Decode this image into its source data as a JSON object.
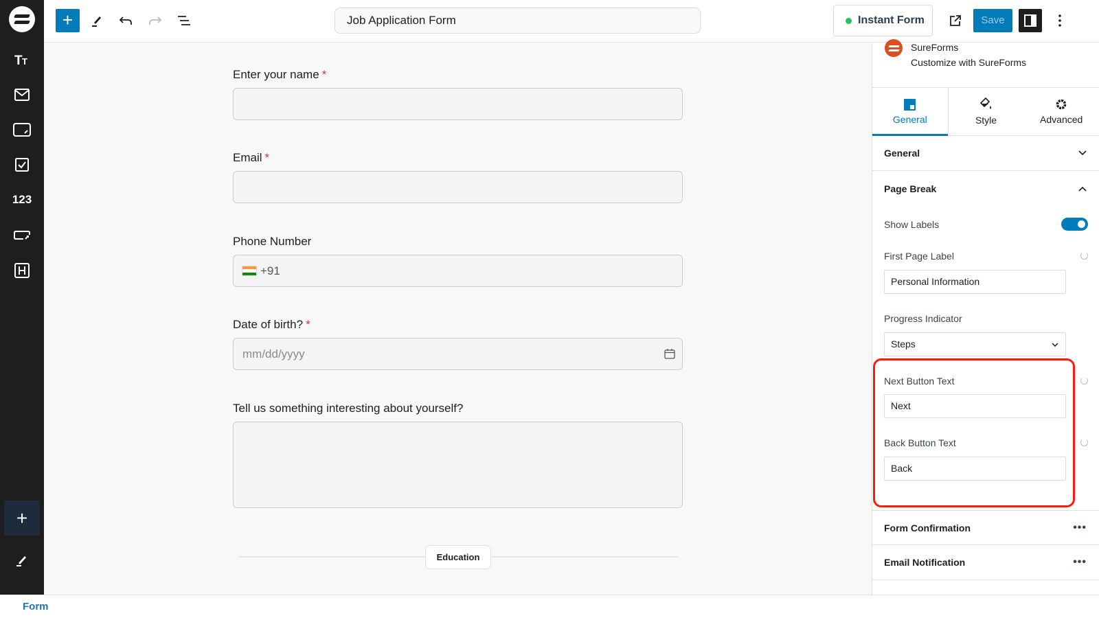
{
  "header": {
    "title": "Job Application Form",
    "instant_form_label": "Instant Form",
    "instant_form_status_color": "#22c55e",
    "save_label": "Save",
    "accent": "#007cba"
  },
  "left_toolbar": {
    "items": [
      {
        "icon": "text-icon"
      },
      {
        "icon": "email-icon"
      },
      {
        "icon": "input-icon"
      },
      {
        "icon": "checkbox-icon"
      },
      {
        "label": "123",
        "icon": "number-icon"
      },
      {
        "icon": "dropdown-icon"
      },
      {
        "icon": "heading-icon"
      }
    ]
  },
  "form": {
    "fields": [
      {
        "label": "Enter your name",
        "required": "*"
      },
      {
        "label": "Email",
        "required": "*"
      },
      {
        "label": "Phone Number",
        "prefix": "+91"
      },
      {
        "label": "Date of birth?",
        "required": "*",
        "placeholder": "mm/dd/yyyy"
      },
      {
        "label": "Tell us something interesting about yourself?"
      }
    ],
    "page_break_label": "Education"
  },
  "sidebar": {
    "brand_name": "SureForms",
    "brand_sub": "Customize with SureForms",
    "tabs": [
      {
        "label": "General",
        "active": true
      },
      {
        "label": "Style"
      },
      {
        "label": "Advanced"
      }
    ],
    "sections": {
      "general": "General",
      "page_break": "Page Break",
      "form_confirmation": "Form Confirmation",
      "email_notification": "Email Notification"
    },
    "page_break": {
      "show_labels_label": "Show Labels",
      "show_labels_value": true,
      "first_page_label": "First Page Label",
      "first_page_value": "Personal Information",
      "progress_indicator_label": "Progress Indicator",
      "progress_indicator_value": "Steps",
      "next_button_label": "Next Button Text",
      "next_button_value": "Next",
      "back_button_label": "Back Button Text",
      "back_button_value": "Back"
    }
  },
  "footer": {
    "breadcrumb": "Form"
  }
}
